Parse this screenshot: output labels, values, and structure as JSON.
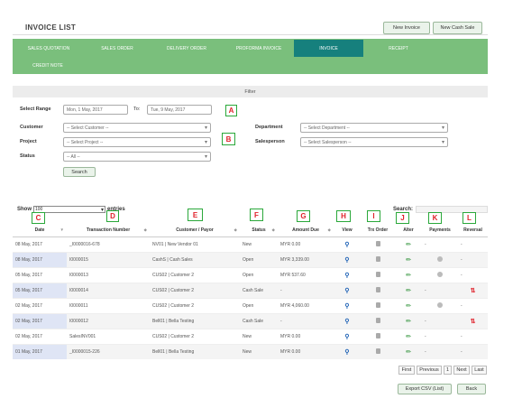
{
  "page_title": "INVOICE LIST",
  "header_buttons": {
    "new_invoice": "New Invoice",
    "new_cash_sale": "New Cash Sale"
  },
  "nav_tabs": [
    "SALES QUOTATION",
    "SALES ORDER",
    "DELIVERY ORDER",
    "PROFORMA INVOICE",
    "INVOICE",
    "RECEIPT",
    "CREDIT NOTE"
  ],
  "nav_active": "INVOICE",
  "filter": {
    "title": "Filter",
    "select_range_label": "Select Range",
    "from_value": "Mon, 1 May, 2017",
    "to_label": "To:",
    "to_value": "Tue, 9 May, 2017",
    "customer_label": "Customer",
    "customer_value": "-- Select Customer --",
    "project_label": "Project",
    "project_value": "-- Select Project --",
    "status_label": "Status",
    "status_value": "-- All --",
    "department_label": "Department",
    "department_value": "-- Select Department --",
    "salesperson_label": "Salesperson",
    "salesperson_value": "-- Select Salesperson --",
    "search_button": "Search"
  },
  "markers": [
    "A",
    "B",
    "C",
    "D",
    "E",
    "F",
    "G",
    "H",
    "I",
    "J",
    "K",
    "L"
  ],
  "table_controls": {
    "show_label": "Show",
    "show_value": "100",
    "entries_label": "entries",
    "search_label": "Search:"
  },
  "columns": [
    "Date",
    "Transaction Number",
    "Customer / Payor",
    "Status",
    "Amount Due",
    "View",
    "Trx Order",
    "Alter",
    "Payments",
    "Reversal"
  ],
  "rows": [
    {
      "date": "08 May, 2017",
      "trx": "_I0000016-678",
      "customer": "NV01 | New Vendor 01",
      "status": "New",
      "amount": "MYR 0.00",
      "payment": "-",
      "reversal": "-"
    },
    {
      "date": "08 May, 2017",
      "trx": "I0000015",
      "customer": "CashS | Cash Sales",
      "status": "Open",
      "amount": "MYR 3,339.00",
      "payment": "icon",
      "reversal": "-"
    },
    {
      "date": "05 May, 2017",
      "trx": "I0000013",
      "customer": "CUS02 | Customer 2",
      "status": "Open",
      "amount": "MYR 537.60",
      "payment": "icon",
      "reversal": "-"
    },
    {
      "date": "05 May, 2017",
      "trx": "I0000014",
      "customer": "CUS02 | Customer 2",
      "status": "Cash Sale",
      "amount": "-",
      "payment": "-",
      "reversal": "icon"
    },
    {
      "date": "02 May, 2017",
      "trx": "I0000011",
      "customer": "CUS02 | Customer 2",
      "status": "Open",
      "amount": "MYR 4,060.00",
      "payment": "icon",
      "reversal": "-"
    },
    {
      "date": "02 May, 2017",
      "trx": "I0000012",
      "customer": "Bell01 | Bella Testing",
      "status": "Cash Sale",
      "amount": "-",
      "payment": "-",
      "reversal": "icon"
    },
    {
      "date": "02 May, 2017",
      "trx": "SalesINV001",
      "customer": "CUS02 | Customer 2",
      "status": "New",
      "amount": "MYR 0.00",
      "payment": "-",
      "reversal": "-"
    },
    {
      "date": "01 May, 2017",
      "trx": "_I0000015-226",
      "customer": "Bell01 | Bella Testing",
      "status": "New",
      "amount": "MYR 0.00",
      "payment": "-",
      "reversal": "-"
    }
  ],
  "pagination": {
    "first": "First",
    "previous": "Previous",
    "page": "1",
    "next": "Next",
    "last": "Last"
  },
  "footer_buttons": {
    "export": "Export CSV (List)",
    "back": "Back"
  },
  "colors": {
    "nav_bg": "#7abf7c",
    "nav_active": "#16807d",
    "marker_border": "#2aa83a",
    "marker_text": "#e0202a"
  }
}
